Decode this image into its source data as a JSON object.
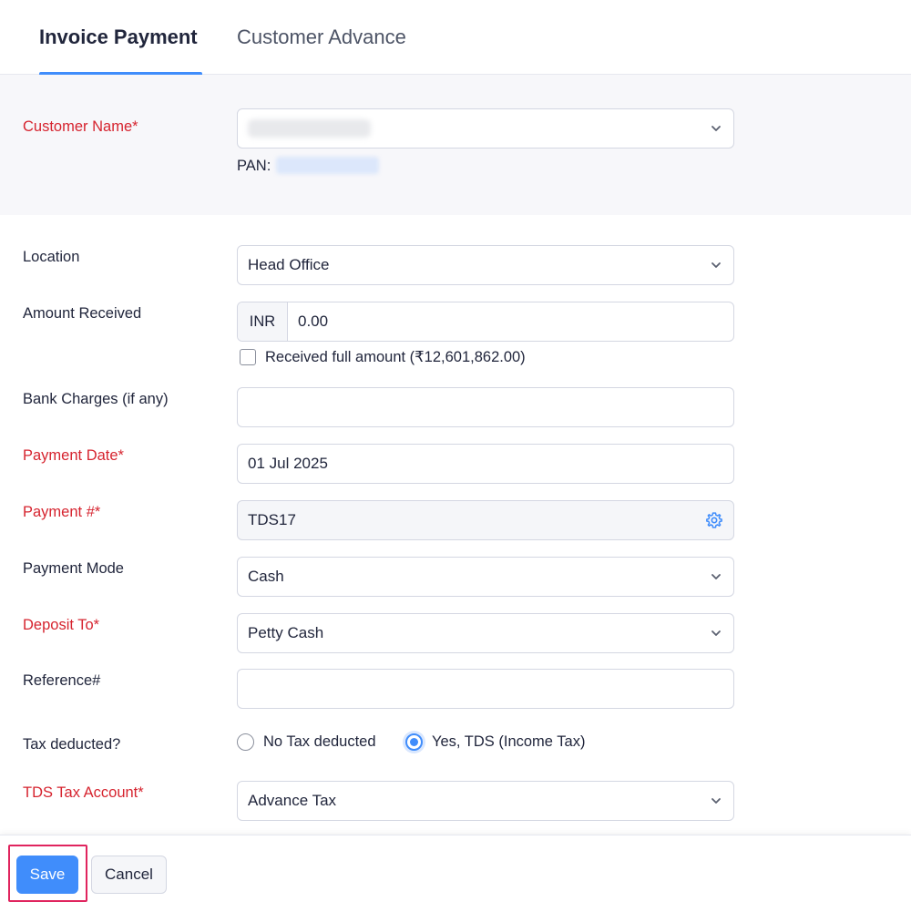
{
  "tabs": [
    {
      "label": "Invoice Payment",
      "active": true
    },
    {
      "label": "Customer Advance",
      "active": false
    }
  ],
  "customer": {
    "label": "Customer Name*",
    "value": "",
    "pan_label": "PAN:",
    "pan_value": ""
  },
  "form": {
    "location": {
      "label": "Location",
      "value": "Head Office"
    },
    "amount": {
      "label": "Amount Received",
      "currency": "INR",
      "value": "0.00",
      "full_amount_label": "Received full amount (₹12,601,862.00)",
      "full_amount_checked": false
    },
    "bank_charges": {
      "label": "Bank Charges (if any)",
      "value": ""
    },
    "payment_date": {
      "label": "Payment Date*",
      "value": "01 Jul 2025"
    },
    "payment_number": {
      "label": "Payment #*",
      "value": "TDS17"
    },
    "payment_mode": {
      "label": "Payment Mode",
      "value": "Cash"
    },
    "deposit_to": {
      "label": "Deposit To*",
      "value": "Petty Cash"
    },
    "reference": {
      "label": "Reference#",
      "value": ""
    },
    "tax_deducted": {
      "label": "Tax deducted?",
      "options": [
        "No Tax deducted",
        "Yes, TDS (Income Tax)"
      ],
      "selected": 1
    },
    "tds_account": {
      "label": "TDS Tax Account*",
      "value": "Advance Tax"
    }
  },
  "footer": {
    "save_label": "Save",
    "cancel_label": "Cancel"
  },
  "colors": {
    "accent": "#408dfb",
    "required": "#d6242f",
    "highlight": "#e0245e"
  },
  "icons": {
    "dropdown": "chevron-down-icon",
    "settings": "gear-icon"
  }
}
